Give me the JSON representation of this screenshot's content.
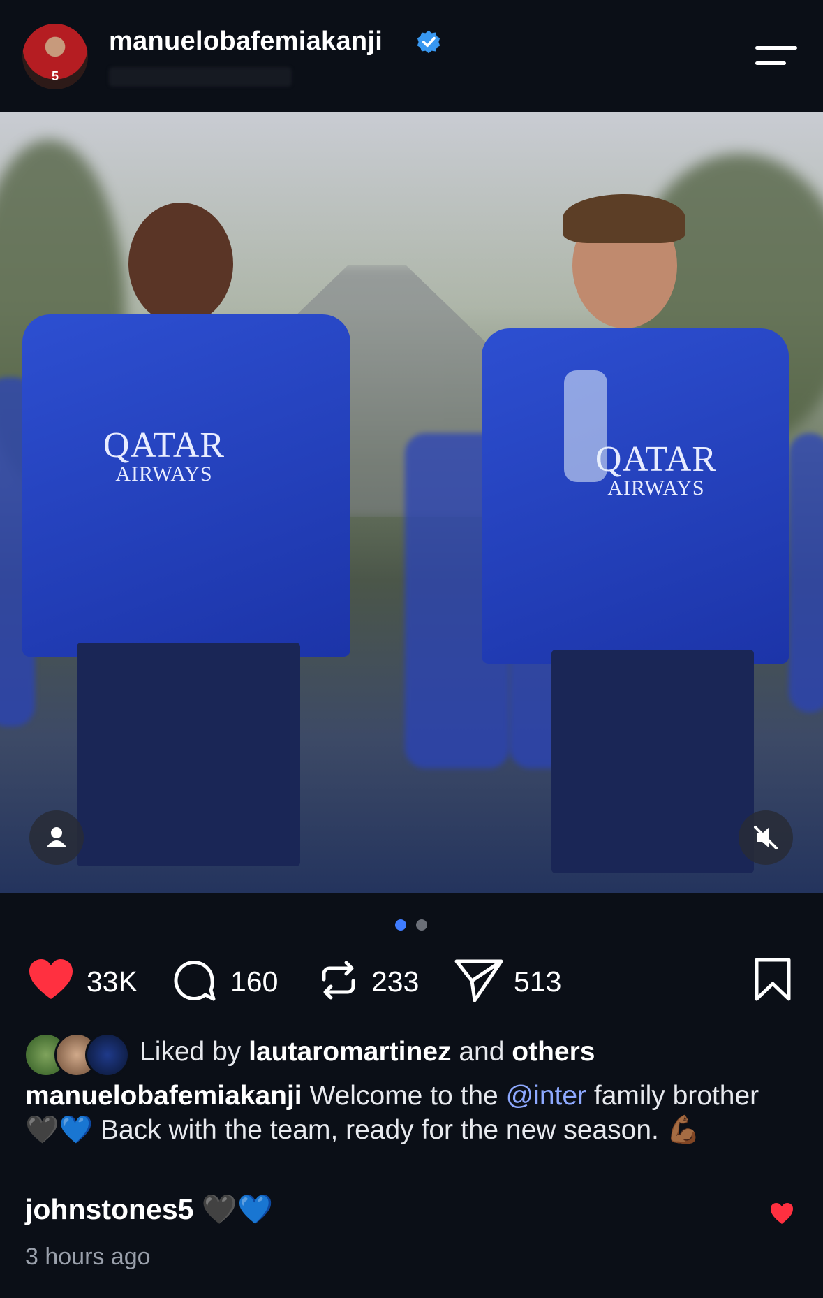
{
  "header": {
    "username": "manuelobafemiakanji",
    "avatar_number": "5",
    "verified_color": "#3897f0"
  },
  "media": {
    "sponsor_line1": "QATAR",
    "sponsor_line2": "AIRWAYS",
    "carousel_count": 2,
    "carousel_active": 0
  },
  "actions": {
    "likes": "33K",
    "comments": "160",
    "reposts": "233",
    "shares": "513"
  },
  "liked_by": {
    "prefix": "Liked by",
    "user": "lautaromartinez",
    "conj": "and",
    "others": "others"
  },
  "caption": {
    "user": "manuelobafemiakanji",
    "text1": "Welcome to the",
    "mention": "@inter",
    "text2": "family brother",
    "emoji1": "🖤💙",
    "text3": "Back with the team, ready for the new season.",
    "emoji2": "💪🏾"
  },
  "comment": {
    "user": "johnstones5",
    "emoji": "🖤💙"
  },
  "timestamp": "3 hours ago",
  "colors": {
    "background": "#0b0f17",
    "like_red": "#ff3040",
    "mention_blue": "#8ea9ff",
    "dot_active": "#3f7cff",
    "dot_inactive": "#6b6f78"
  }
}
